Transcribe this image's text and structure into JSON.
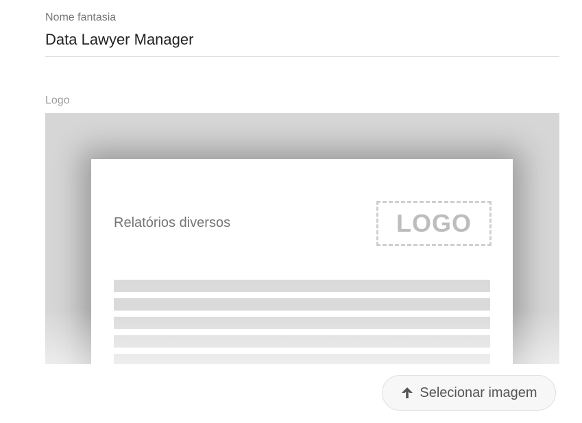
{
  "form": {
    "name_field": {
      "label": "Nome fantasia",
      "value": "Data Lawyer Manager"
    },
    "logo_field": {
      "label": "Logo"
    }
  },
  "preview": {
    "report_title": "Relatórios diversos",
    "logo_placeholder": "LOGO",
    "text_lines_count": 5
  },
  "upload_button": {
    "label": "Selecionar imagem",
    "icon": "arrow-up-icon"
  },
  "colors": {
    "preview_background": "#d6d6d6",
    "placeholder_line": "#dadada"
  }
}
